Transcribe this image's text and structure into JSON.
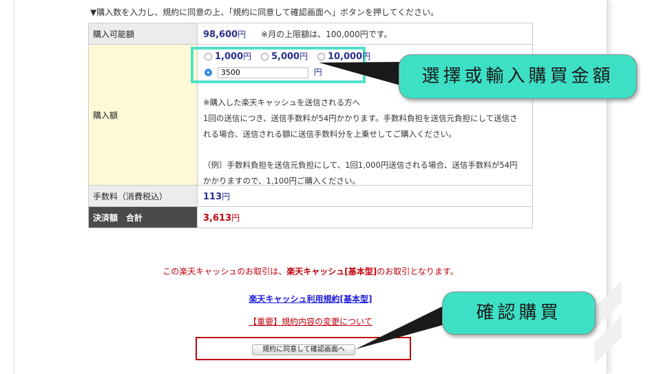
{
  "instruction": "▼購入数を入力し、規約に同意の上、「規約に同意して確認画面へ」ボタンを押してください。",
  "rows": {
    "available": {
      "label": "購入可能額",
      "amount": "98,600",
      "unit": "円",
      "note": "※月の上限額は、100,000円です。"
    },
    "purchase": {
      "label": "購入額",
      "options": [
        {
          "amount": "1,000",
          "unit": "円",
          "selected": false
        },
        {
          "amount": "5,000",
          "unit": "円",
          "selected": false
        },
        {
          "amount": "10,000",
          "unit": "円",
          "selected": false
        }
      ],
      "custom_value": "3500",
      "custom_unit": "円",
      "desc_line1": "※購入した楽天キャッシュを送信される方へ",
      "desc_line2": "1回の送信につき、送信手数料が54円かかります。手数料負担を送信元負担にして送信さ",
      "desc_line3": "れる場合、送信される額に送信手数料分を上乗せしてご購入ください。",
      "desc_line4": "（例）手数料負担を送信元負担にして、1回1,000円送信される場合、送信手数料が54円",
      "desc_line5": "かかりますので、1,100円ご購入ください。"
    },
    "fee": {
      "label": "手数料（消費税込）",
      "amount": "113",
      "unit": "円"
    },
    "total": {
      "label": "決済額　合計",
      "amount": "3,613",
      "unit": "円"
    }
  },
  "notice_prefix": "この楽天キャッシュのお取引は、",
  "notice_bold": "楽天キャッシュ[基本型]",
  "notice_suffix": "のお取引となります。",
  "terms_link": "楽天キャッシュ利用規約[基本型]",
  "change_link": "【重要】規約内容の変更について",
  "confirm_button": "規約に同意して確認画面へ",
  "callouts": {
    "select_amount": "選擇或輸入購買金額",
    "confirm_purchase": "確認購買"
  },
  "colors": {
    "highlight": "#4fe0c8",
    "callout": "#3de0c4",
    "accent_red": "#c0000b",
    "amount_blue": "#2b2f8f",
    "link_blue": "#1a1adb"
  }
}
